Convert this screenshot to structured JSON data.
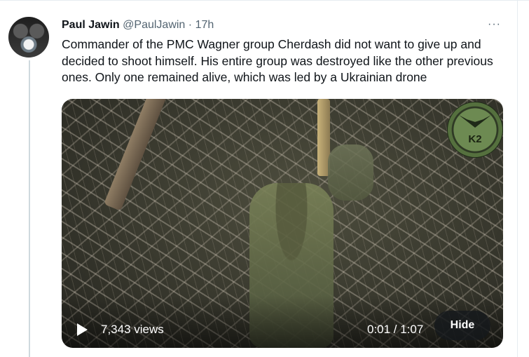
{
  "tweet": {
    "author_name": "Paul Jawin",
    "handle": "@PaulJawin",
    "separator": "·",
    "time": "17h",
    "more": "···",
    "text": "Commander of the PMC Wagner group Cherdash did not want to give up and decided to shoot himself. His entire group was destroyed like the other previous ones. Only one remained alive, which was led by a Ukrainian drone"
  },
  "video": {
    "watermark": "K2",
    "views": "7,343 views",
    "timer": "0:01 / 1:07",
    "hide_label": "Hide"
  },
  "colors": {
    "text_primary": "#0f1419",
    "text_secondary": "#536471",
    "thread_line": "#cfd9de",
    "border": "#e6ecf0"
  }
}
